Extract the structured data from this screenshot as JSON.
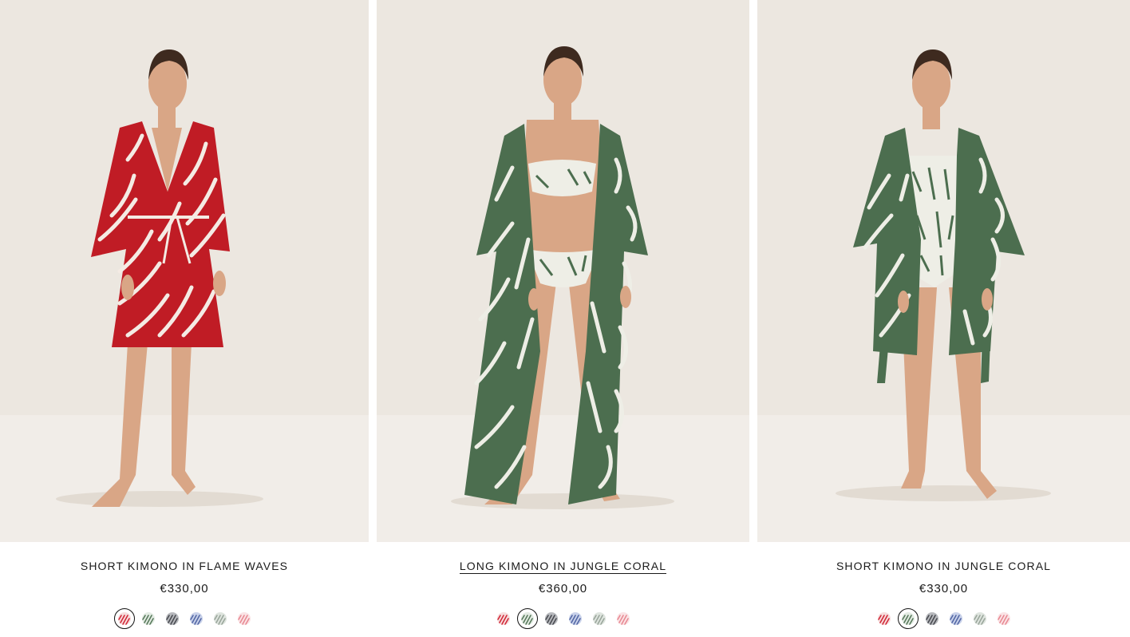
{
  "products": [
    {
      "title": "SHORT KIMONO IN FLAME WAVES",
      "price": "€330,00",
      "selected_swatch": 0,
      "garment_color": "#c01c25",
      "accent_color": "#f4ebe4",
      "underlined": false
    },
    {
      "title": "LONG KIMONO IN JUNGLE CORAL",
      "price": "€360,00",
      "selected_swatch": 1,
      "garment_color": "#4c6e4f",
      "accent_color": "#eeeee6",
      "underlined": true
    },
    {
      "title": "SHORT KIMONO IN JUNGLE CORAL",
      "price": "€330,00",
      "selected_swatch": 1,
      "garment_color": "#4c6e4f",
      "accent_color": "#eeeee6",
      "underlined": false
    }
  ],
  "swatches": [
    {
      "name": "flame-waves-red",
      "base": "#f7dede",
      "stripe": "#d22a3a"
    },
    {
      "name": "jungle-coral-green",
      "base": "#e4ece4",
      "stripe": "#587a5c"
    },
    {
      "name": "charcoal-print",
      "base": "#b7b9bd",
      "stripe": "#4a4c52"
    },
    {
      "name": "blue-print",
      "base": "#c9d2ea",
      "stripe": "#5468a6"
    },
    {
      "name": "sage-print",
      "base": "#dfe5df",
      "stripe": "#9aa69c"
    },
    {
      "name": "pink-print",
      "base": "#fbe4e6",
      "stripe": "#e88a94"
    }
  ],
  "colors": {
    "backdrop_top": "#ece7e0",
    "backdrop_floor": "#f1ede8",
    "skin": "#d9a686",
    "hair": "#3e2a1f"
  }
}
